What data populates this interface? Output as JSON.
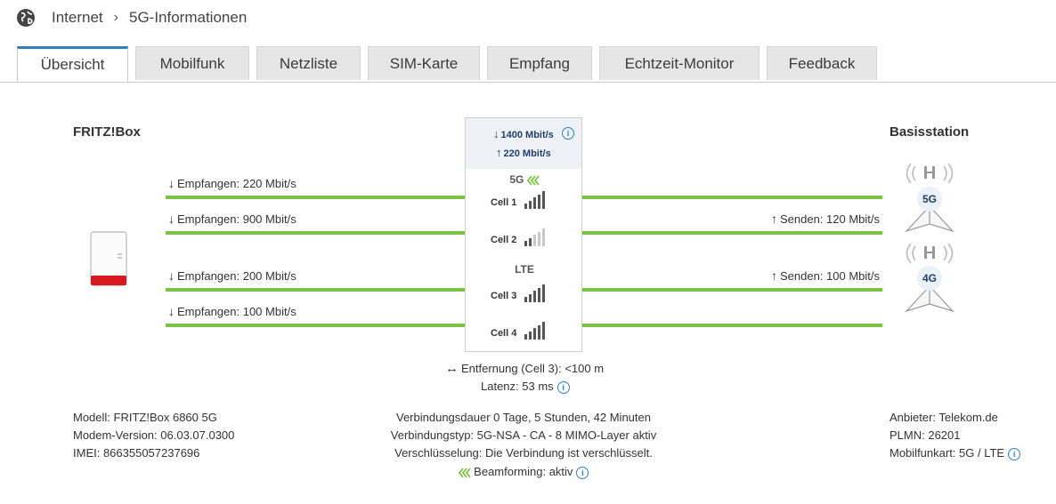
{
  "breadcrumb": {
    "root": "Internet",
    "current": "5G-Informationen"
  },
  "tabs": [
    "Übersicht",
    "Mobilfunk",
    "Netzliste",
    "SIM-Karte",
    "Empfang",
    "Echtzeit-Monitor",
    "Feedback"
  ],
  "left": {
    "title": "FRITZ!Box"
  },
  "right": {
    "title": "Basisstation"
  },
  "links": [
    {
      "down": "Empfangen: 220 Mbit/s",
      "up": ""
    },
    {
      "down": "Empfangen: 900 Mbit/s",
      "up": "Senden: 120 Mbit/s"
    },
    {
      "down": "Empfangen: 200 Mbit/s",
      "up": "Senden: 100 Mbit/s"
    },
    {
      "down": "Empfangen: 100 Mbit/s",
      "up": ""
    }
  ],
  "summary": {
    "down": "1400 Mbit/s",
    "up": "220 Mbit/s"
  },
  "bands": {
    "nr": "5G",
    "lte": "LTE"
  },
  "cells": [
    {
      "label": "Cell 1",
      "signal": 5
    },
    {
      "label": "Cell 2",
      "signal": 2
    },
    {
      "label": "Cell 3",
      "signal": 5
    },
    {
      "label": "Cell 4",
      "signal": 5
    }
  ],
  "towers": [
    "5G",
    "4G"
  ],
  "distance": "Entfernung (Cell 3): <100 m",
  "latency": "Latenz: 53 ms",
  "device": {
    "model": "Modell: FRITZ!Box 6860 5G",
    "modem": "Modem-Version: 06.03.07.0300",
    "imei": "IMEI: 866355057237696"
  },
  "connection": {
    "duration": "Verbindungsdauer 0 Tage, 5 Stunden, 42 Minuten",
    "type": "Verbindungstyp: 5G-NSA - CA - 8 MIMO-Layer aktiv",
    "encryption": "Verschlüsselung: Die Verbindung ist verschlüsselt.",
    "beamforming": "Beamforming: aktiv"
  },
  "provider": {
    "name": "Anbieter: Telekom.de",
    "plmn": "PLMN: 26201",
    "radio": "Mobilfunkart: 5G / LTE"
  },
  "colors": {
    "accent": "#2f7fc1",
    "line": "#7dc242",
    "signal_on": "#555555",
    "signal_off": "#c8c8c8"
  }
}
